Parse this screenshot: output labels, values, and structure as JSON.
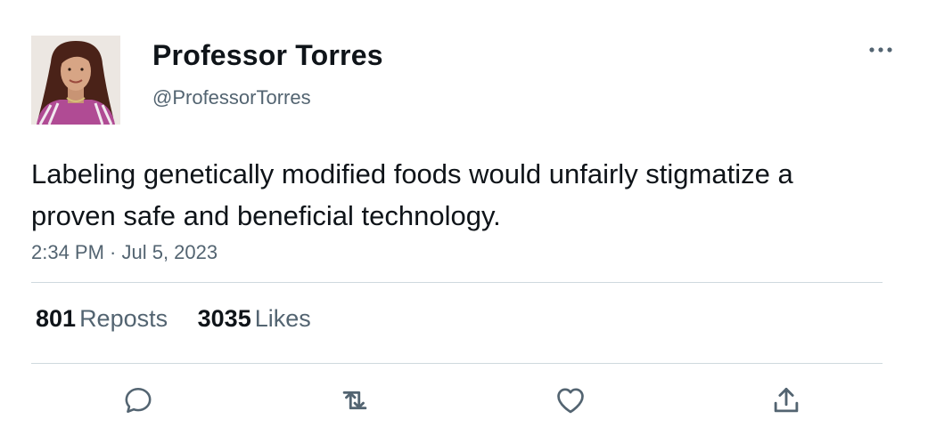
{
  "user": {
    "display_name": "Professor Torres",
    "handle": "@ProfessorTorres"
  },
  "tweet": {
    "text": "Labeling genetically modified foods would unfairly stigmatize a proven safe and beneficial technology.",
    "timestamp": "2:34 PM · Jul 5, 2023"
  },
  "stats": {
    "reposts_count": "801",
    "reposts_label": "Reposts",
    "likes_count": "3035",
    "likes_label": "Likes"
  },
  "actions": [
    "reply-icon",
    "repost-icon",
    "like-icon",
    "share-icon"
  ],
  "colors": {
    "text_primary": "#0f1419",
    "text_secondary": "#536471",
    "divider": "#cfd9de",
    "icon": "#536471"
  }
}
